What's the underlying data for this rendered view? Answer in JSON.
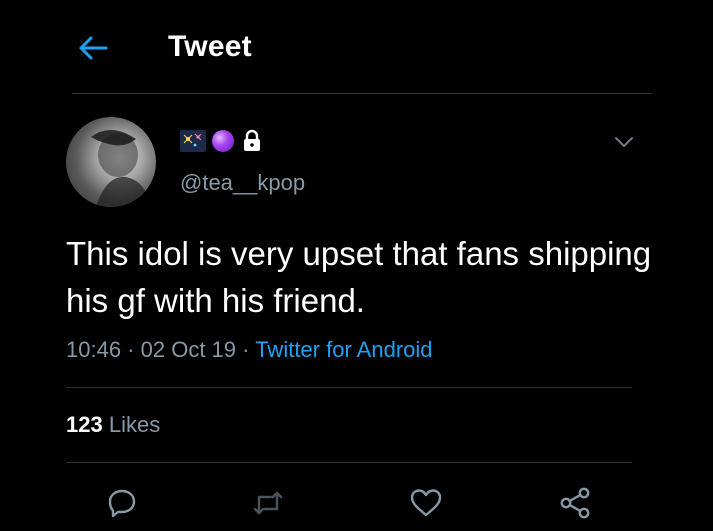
{
  "header": {
    "title": "Tweet",
    "back_icon": "arrow-left-icon"
  },
  "tweet": {
    "handle": "@tea__kpop",
    "name_emojis": [
      "fireworks-emoji",
      "crystal-ball-emoji"
    ],
    "protected": true,
    "text": "This idol is very upset that fans shipping his gf with his friend.",
    "time": "10:46",
    "date": "02 Oct 19",
    "separator": "·",
    "source": "Twitter for Android",
    "likes_count": "123",
    "likes_label": "Likes"
  },
  "actions": [
    "reply-icon",
    "retweet-icon",
    "like-icon",
    "share-icon"
  ],
  "colors": {
    "background": "#000000",
    "accent": "#1da1f2",
    "secondary_text": "#8899a6",
    "divider": "#2a2d31"
  }
}
